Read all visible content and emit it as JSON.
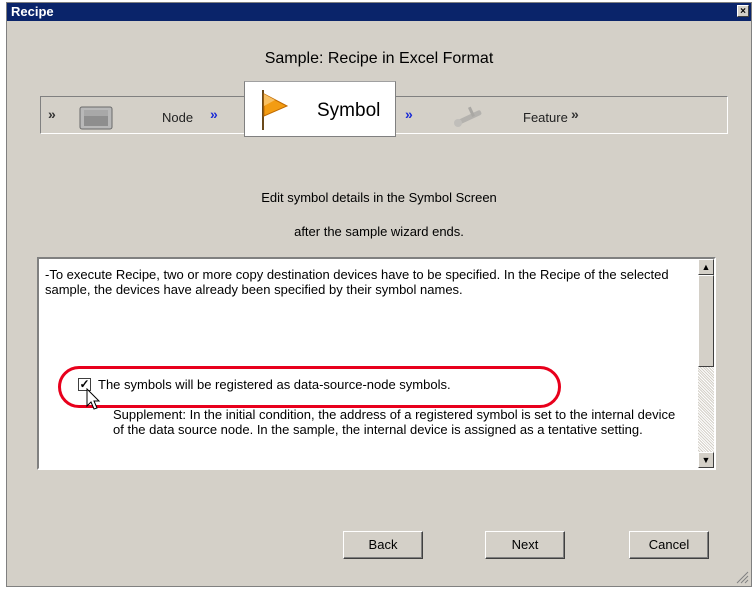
{
  "window": {
    "title": "Recipe",
    "close_glyph": "×"
  },
  "heading": "Sample: Recipe in Excel Format",
  "steps": {
    "node": {
      "label": "Node",
      "icon": "monitor-icon"
    },
    "symbol": {
      "label": "Symbol",
      "icon": "flag-icon",
      "active": true
    },
    "feature": {
      "label": "Feature",
      "icon": "tool-icon"
    },
    "chevron": "»"
  },
  "description": {
    "line1": "Edit symbol details in the Symbol Screen",
    "line2": "after the sample wizard ends."
  },
  "content": {
    "paragraph": "-To execute Recipe, two or more copy destination devices have to be specified. In the Recipe of the selected sample, the devices have already been specified by their symbol names.",
    "checkbox_label": "The symbols will be registered as data-source-node symbols.",
    "checkbox_checked": true,
    "checkbox_mark": "✓",
    "supplement": "Supplement: In the initial condition, the address of a registered symbol is set to the internal device of the data source node. In the sample, the internal device is assigned as a tentative setting."
  },
  "scrollbar": {
    "up_glyph": "▲",
    "down_glyph": "▼"
  },
  "buttons": {
    "back": "Back",
    "next": "Next",
    "cancel": "Cancel"
  },
  "colors": {
    "titlebar": "#0a246a",
    "highlight": "#e8001c",
    "chevron_blue": "#1a2bd6",
    "dialog_bg": "#d4d0c8"
  }
}
